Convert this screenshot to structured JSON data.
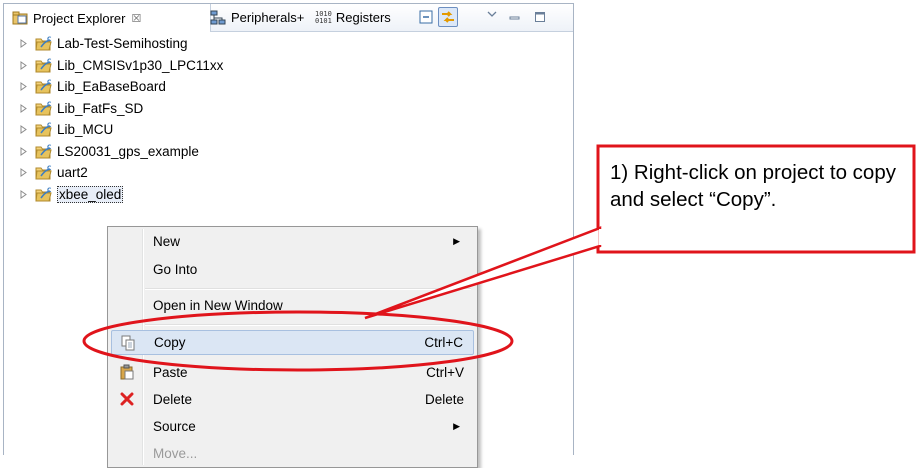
{
  "tabs": {
    "project_explorer": "Project Explorer",
    "close_glyph": "☒",
    "peripherals": "Peripherals+",
    "registers": "Registers",
    "registers_icon_glyph": "1010\n0101"
  },
  "tree": {
    "items": [
      {
        "label": "Lab-Test-Semihosting"
      },
      {
        "label": "Lib_CMSISv1p30_LPC11xx"
      },
      {
        "label": "Lib_EaBaseBoard"
      },
      {
        "label": "Lib_FatFs_SD"
      },
      {
        "label": "Lib_MCU"
      },
      {
        "label": "LS20031_gps_example"
      },
      {
        "label": "uart2"
      },
      {
        "label": "xbee_oled"
      }
    ]
  },
  "context_menu": {
    "items": [
      {
        "label": "New",
        "accel": "",
        "submenu": true
      },
      {
        "label": "Go Into",
        "accel": ""
      },
      {
        "label": "Open in New Window",
        "accel": ""
      },
      {
        "label": "Copy",
        "accel": "Ctrl+C"
      },
      {
        "label": "Paste",
        "accel": "Ctrl+V"
      },
      {
        "label": "Delete",
        "accel": "Delete"
      },
      {
        "label": "Source",
        "accel": "",
        "submenu": true
      },
      {
        "label": "Move...",
        "accel": ""
      }
    ]
  },
  "annotation": {
    "text": "1) Right-click on project to copy and select “Copy”.",
    "color": "#e0141b"
  },
  "colors": {
    "menu_hover": "#dbe6f4",
    "annotation_red": "#e0141b"
  }
}
